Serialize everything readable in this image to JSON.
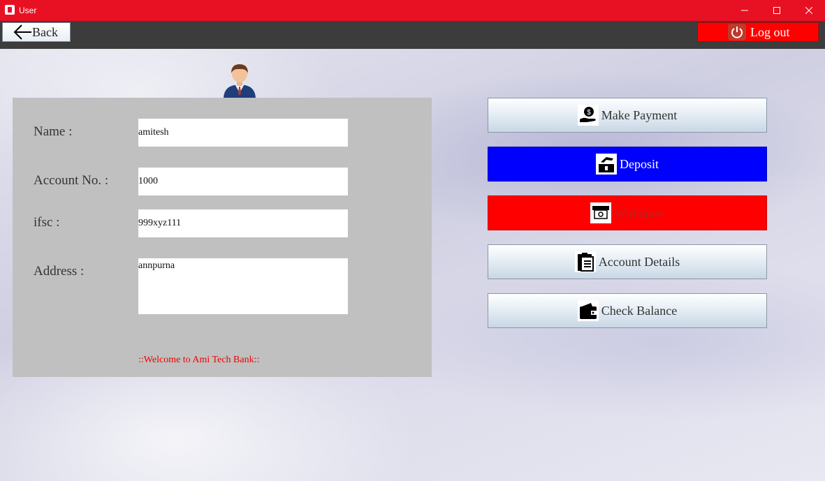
{
  "window": {
    "title": "User"
  },
  "toolbar": {
    "back_label": "Back",
    "logout_label": "Log out"
  },
  "profile": {
    "fields": [
      {
        "label": "Name :",
        "value": "amitesh"
      },
      {
        "label": "Account No. :",
        "value": "1000"
      },
      {
        "label": "ifsc :",
        "value": "999xyz111"
      },
      {
        "label": "Address :",
        "value": "annpurna"
      }
    ],
    "welcome": "::Welcome to Ami Tech Bank::"
  },
  "actions": [
    {
      "label": "Make Payment",
      "icon": "payment-icon"
    },
    {
      "label": "Deposit",
      "icon": "deposit-icon",
      "color": "#0000ff"
    },
    {
      "label": "Withdraw",
      "icon": "withdraw-icon",
      "color": "#ff0000"
    },
    {
      "label": "Account Details",
      "icon": "clipboard-icon"
    },
    {
      "label": "Check Balance",
      "icon": "wallet-icon"
    }
  ],
  "colors": {
    "titlebar": "#e81123",
    "toolbar": "#3c3c3c",
    "panel": "#c0c0c0"
  }
}
